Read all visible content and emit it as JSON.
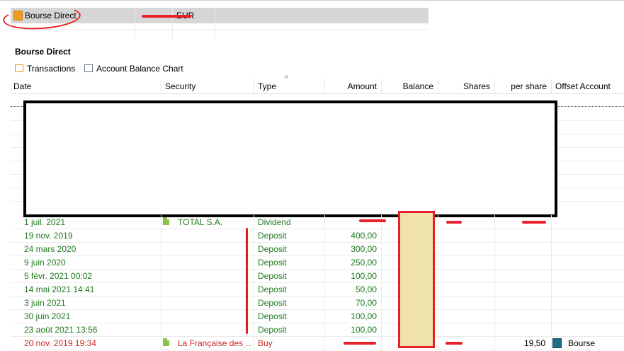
{
  "accounts": {
    "name": "Bourse Direct",
    "currency": "EUR"
  },
  "section": {
    "title": "Bourse Direct",
    "tabs": [
      {
        "label": "Transactions",
        "icon": "transactions-icon"
      },
      {
        "label": "Account Balance Chart",
        "icon": "chart-icon"
      }
    ]
  },
  "columns": {
    "date": "Date",
    "security": "Security",
    "type": "Type",
    "amount": "Amount",
    "balance": "Balance",
    "shares": "Shares",
    "per_share": "per share",
    "offset": "Offset Account"
  },
  "rows": [
    {
      "date": "1 juil. 2021",
      "security": "TOTAL S.A.",
      "type": "Dividend",
      "amount": "",
      "per_share": "",
      "offset": ""
    },
    {
      "date": "19 nov. 2019",
      "security": "",
      "type": "Deposit",
      "amount": "400,00",
      "per_share": "",
      "offset": ""
    },
    {
      "date": "24 mars 2020",
      "security": "",
      "type": "Deposit",
      "amount": "300,00",
      "per_share": "",
      "offset": ""
    },
    {
      "date": "9 juin 2020",
      "security": "",
      "type": "Deposit",
      "amount": "250,00",
      "per_share": "",
      "offset": ""
    },
    {
      "date": "5 févr. 2021 00:02",
      "security": "",
      "type": "Deposit",
      "amount": "100,00",
      "per_share": "",
      "offset": ""
    },
    {
      "date": "14 mai 2021 14:41",
      "security": "",
      "type": "Deposit",
      "amount": "50,00",
      "per_share": "",
      "offset": ""
    },
    {
      "date": "3 juin 2021",
      "security": "",
      "type": "Deposit",
      "amount": "70,00",
      "per_share": "",
      "offset": ""
    },
    {
      "date": "30 juin 2021",
      "security": "",
      "type": "Deposit",
      "amount": "100,00",
      "per_share": "",
      "offset": ""
    },
    {
      "date": "23 août 2021 13:56",
      "security": "",
      "type": "Deposit",
      "amount": "100,00",
      "per_share": "",
      "offset": ""
    },
    {
      "date": "20 nov. 2019 19:34",
      "security": "La Française des …",
      "type": "Buy",
      "amount": "",
      "per_share": "19,50",
      "offset": "Bourse"
    }
  ],
  "colors": {
    "green_text": "#1f7a1f",
    "red_text": "#cc2a2a",
    "annotation_red": "#e8202a",
    "balance_fill": "#efe2ab",
    "selected_row": "#d6d6d6"
  }
}
